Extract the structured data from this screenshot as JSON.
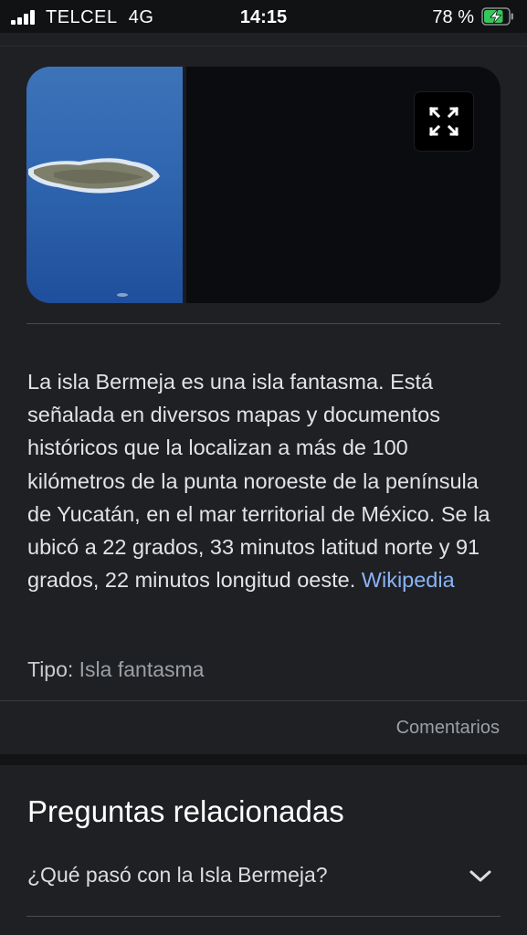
{
  "status_bar": {
    "carrier": "TELCEL",
    "network": "4G",
    "time": "14:15",
    "battery_percent": "78 %",
    "battery_level": 0.78,
    "charging": true
  },
  "media": {
    "expand_icon": "expand-icon",
    "image_subject": "aerial photo of island"
  },
  "description": {
    "text": "La isla Bermeja es una isla fantasma. Está señalada en diversos mapas y documentos históricos que la localizan a más de 100 kilómetros de la punta noroeste de la península de Yucatán, en el mar territorial de México. Se la ubicó a 22 grados, 33 minutos latitud norte y 91 grados, 22 minutos longitud oeste.",
    "source_link": "Wikipedia"
  },
  "type": {
    "label": "Tipo:",
    "value": "Isla fantasma"
  },
  "feedback": "Comentarios",
  "related": {
    "title": "Preguntas relacionadas",
    "questions": [
      {
        "text": "¿Qué pasó con la Isla Bermeja?",
        "icon": "chevron-down-icon"
      }
    ]
  },
  "colors": {
    "background": "#1f2023",
    "link": "#8ab4f8",
    "status_bar": "#111214",
    "battery_charge": "#34c759"
  }
}
